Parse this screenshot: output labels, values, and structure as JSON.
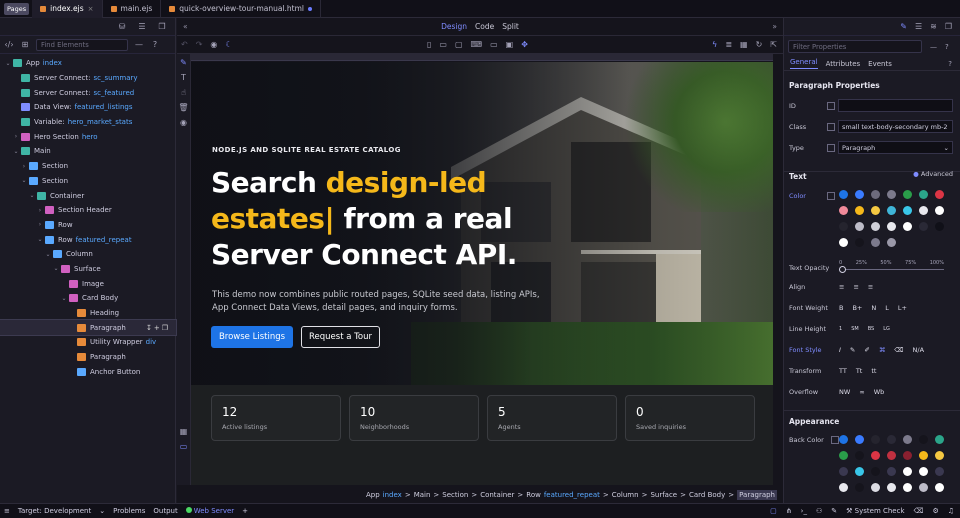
{
  "tabs": {
    "pages_badge": "Pages",
    "items": [
      {
        "label": "index.ejs",
        "close": "×"
      },
      {
        "label": "main.ejs"
      },
      {
        "label": "quick-overview-tour-manual.html"
      }
    ]
  },
  "left": {
    "find_placeholder": "Find Elements",
    "tree": [
      {
        "label": "App",
        "accent": "index",
        "depth": 0,
        "caret": "⌄",
        "color": "#3fb5a5"
      },
      {
        "label": "Server Connect:",
        "accent": "sc_summary",
        "depth": 1,
        "caret": "",
        "color": "#3fb5a5"
      },
      {
        "label": "Server Connect:",
        "accent": "sc_featured",
        "depth": 1,
        "caret": "",
        "color": "#3fb5a5"
      },
      {
        "label": "Data View:",
        "accent": "featured_listings",
        "depth": 1,
        "caret": "",
        "color": "#7f8cff"
      },
      {
        "label": "Variable:",
        "accent": "hero_market_stats",
        "depth": 1,
        "caret": "",
        "color": "#3fb5a5"
      },
      {
        "label": "Hero Section",
        "accent": "hero",
        "depth": 1,
        "caret": "›",
        "color": "#d060c0"
      },
      {
        "label": "Main",
        "accent": "",
        "depth": 1,
        "caret": "⌄",
        "color": "#3fb5a5"
      },
      {
        "label": "Section",
        "accent": "",
        "depth": 2,
        "caret": "›",
        "color": "#5aa9ff"
      },
      {
        "label": "Section",
        "accent": "",
        "depth": 2,
        "caret": "⌄",
        "color": "#5aa9ff"
      },
      {
        "label": "Container",
        "accent": "",
        "depth": 3,
        "caret": "⌄",
        "color": "#3fb5a5"
      },
      {
        "label": "Section Header",
        "accent": "",
        "depth": 4,
        "caret": "›",
        "color": "#d060c0"
      },
      {
        "label": "Row",
        "accent": "",
        "depth": 4,
        "caret": "›",
        "color": "#5aa9ff"
      },
      {
        "label": "Row",
        "accent": "featured_repeat",
        "depth": 4,
        "caret": "⌄",
        "color": "#5aa9ff"
      },
      {
        "label": "Column",
        "accent": "",
        "depth": 5,
        "caret": "⌄",
        "color": "#5aa9ff"
      },
      {
        "label": "Surface",
        "accent": "",
        "depth": 6,
        "caret": "⌄",
        "color": "#d060c0"
      },
      {
        "label": "Image",
        "accent": "",
        "depth": 7,
        "caret": "",
        "color": "#d060c0"
      },
      {
        "label": "Card Body",
        "accent": "",
        "depth": 7,
        "caret": "⌄",
        "color": "#d060c0"
      },
      {
        "label": "Heading",
        "accent": "",
        "depth": 8,
        "caret": "",
        "color": "#e68a3a"
      },
      {
        "label": "Paragraph",
        "accent": "",
        "depth": 8,
        "caret": "",
        "color": "#e68a3a",
        "selected": true
      },
      {
        "label": "Utility Wrapper",
        "accent": "div",
        "depth": 8,
        "caret": "",
        "color": "#e68a3a"
      },
      {
        "label": "Paragraph",
        "accent": "",
        "depth": 8,
        "caret": "",
        "color": "#e68a3a"
      },
      {
        "label": "Anchor Button",
        "accent": "",
        "depth": 8,
        "caret": "",
        "color": "#5aa9ff"
      }
    ]
  },
  "center": {
    "modes": [
      "Design",
      "Code",
      "Split"
    ],
    "hero": {
      "eyebrow": "NODE.JS AND SQLITE REAL ESTATE CATALOG",
      "title_a": "Search ",
      "title_hl": "design-led estates|",
      "title_b": " from a real Server Connect API.",
      "lead": "This demo now combines public routed pages, SQLite seed data, listing APIs, App Connect Data Views, detail pages, and inquiry forms.",
      "btn_primary": "Browse Listings",
      "btn_secondary": "Request a Tour"
    },
    "stats": [
      {
        "n": "12",
        "label": "Active listings"
      },
      {
        "n": "10",
        "label": "Neighborhoods"
      },
      {
        "n": "5",
        "label": "Agents"
      },
      {
        "n": "0",
        "label": "Saved inquiries"
      }
    ],
    "breadcrumb": [
      {
        "t": "App"
      },
      {
        "t": "index",
        "acc": true
      },
      {
        "t": ">"
      },
      {
        "t": "Main"
      },
      {
        "t": ">"
      },
      {
        "t": "Section"
      },
      {
        "t": ">"
      },
      {
        "t": "Container"
      },
      {
        "t": ">"
      },
      {
        "t": "Row"
      },
      {
        "t": "featured_repeat",
        "acc": true
      },
      {
        "t": ">"
      },
      {
        "t": "Column"
      },
      {
        "t": ">"
      },
      {
        "t": "Surface"
      },
      {
        "t": ">"
      },
      {
        "t": "Card Body"
      },
      {
        "t": ">"
      },
      {
        "t": "Paragraph",
        "cur": true
      }
    ]
  },
  "right": {
    "filter_placeholder": "Filter Properties",
    "tabs": [
      "General",
      "Attributes",
      "Events"
    ],
    "section_paragraph": "Paragraph Properties",
    "id_label": "ID",
    "id_value": "",
    "class_label": "Class",
    "class_value": "small text-body-secondary mb-2",
    "type_label": "Type",
    "type_value": "Paragraph",
    "text_section": "Text",
    "advanced": "Advanced",
    "color_label": "Color",
    "text_colors": [
      "#1e74e6",
      "#3a7bff",
      "#6c6a7c",
      "#7c7a8c",
      "#2a9d4a",
      "#2ba58a",
      "#dc3545",
      "#f08a9a",
      "#f5b81a",
      "#f5c842",
      "#3fb5d8",
      "#39c6e8",
      "#e8e8ee",
      "#ffffff",
      "#25242e",
      "#bdbcc8",
      "#d0d0d8",
      "#e8e8ee",
      "#ffffff",
      "#2a2936",
      "#101018",
      "#ffffff",
      "#15141c",
      "#7c7a8c",
      "#9a98a8"
    ],
    "opacity_label": "Text Opacity",
    "opacity_ticks": [
      "0",
      "25%",
      "50%",
      "75%",
      "100%"
    ],
    "opacity_value": 0,
    "align_label": "Align",
    "weight_label": "Font Weight",
    "weight_opts": [
      "B",
      "B+",
      "N",
      "L",
      "L+"
    ],
    "lh_label": "Line Height",
    "lh_opts": [
      "1",
      "SM",
      "BS",
      "LG"
    ],
    "style_label": "Font Style",
    "style_opts": [
      "N/A"
    ],
    "transform_label": "Transform",
    "transform_opts": [
      "TT",
      "Tt",
      "tt"
    ],
    "overflow_label": "Overflow",
    "overflow_opts": [
      "NW",
      "∞",
      "Wb"
    ],
    "appearance": "Appearance",
    "bg_label": "Back Color",
    "bg_colors": [
      "#1e74e6",
      "#3a7bff",
      "#25242e",
      "#2a2936",
      "#7c7a8c",
      "#15141c",
      "#2ba58a",
      "#2a9d4a",
      "#15141c",
      "#dc3545",
      "#c03040",
      "#8a2030",
      "#f5b81a",
      "#f5c842",
      "#3a3850",
      "#39c6e8",
      "#15141c",
      "#3a3850",
      "#ffffff",
      "#ffffff",
      "#3a3850",
      "#e8e8ee",
      "#15141c",
      "#dcdce4",
      "#e8e8ee",
      "#ffffff",
      "#bdbcc8",
      "#ffffff"
    ]
  },
  "status": {
    "target": "Target: Development",
    "problems": "Problems",
    "output": "Output",
    "server": "Web Server",
    "plus": "+",
    "system_check": "System Check"
  }
}
